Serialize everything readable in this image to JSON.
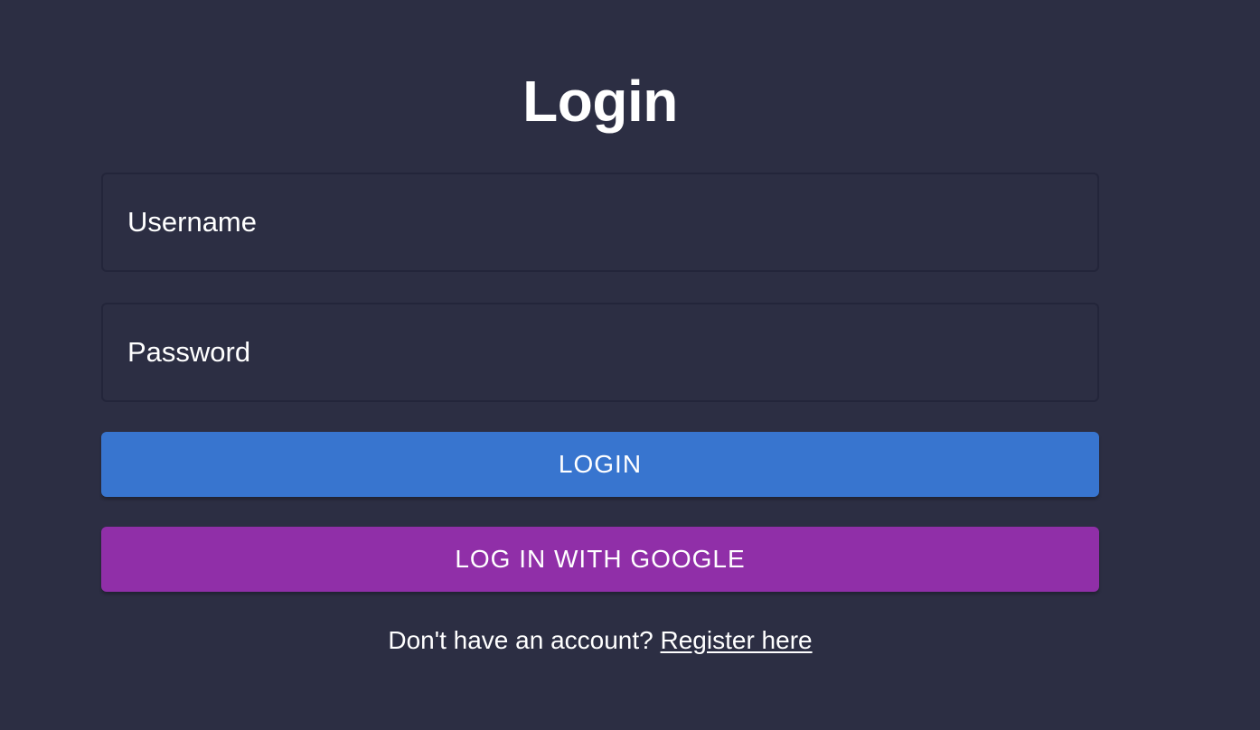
{
  "colors": {
    "background": "#2c2e43",
    "login_button": "#3875cf",
    "google_button": "#902fa8",
    "text": "#ffffff"
  },
  "page": {
    "title": "Login"
  },
  "form": {
    "username": {
      "value": "",
      "placeholder": "Username"
    },
    "password": {
      "value": "",
      "placeholder": "Password"
    },
    "login_label": "LOGIN",
    "google_label": "LOG IN WITH GOOGLE"
  },
  "footer": {
    "prompt": "Don't have an account?",
    "register_link": "Register here"
  }
}
